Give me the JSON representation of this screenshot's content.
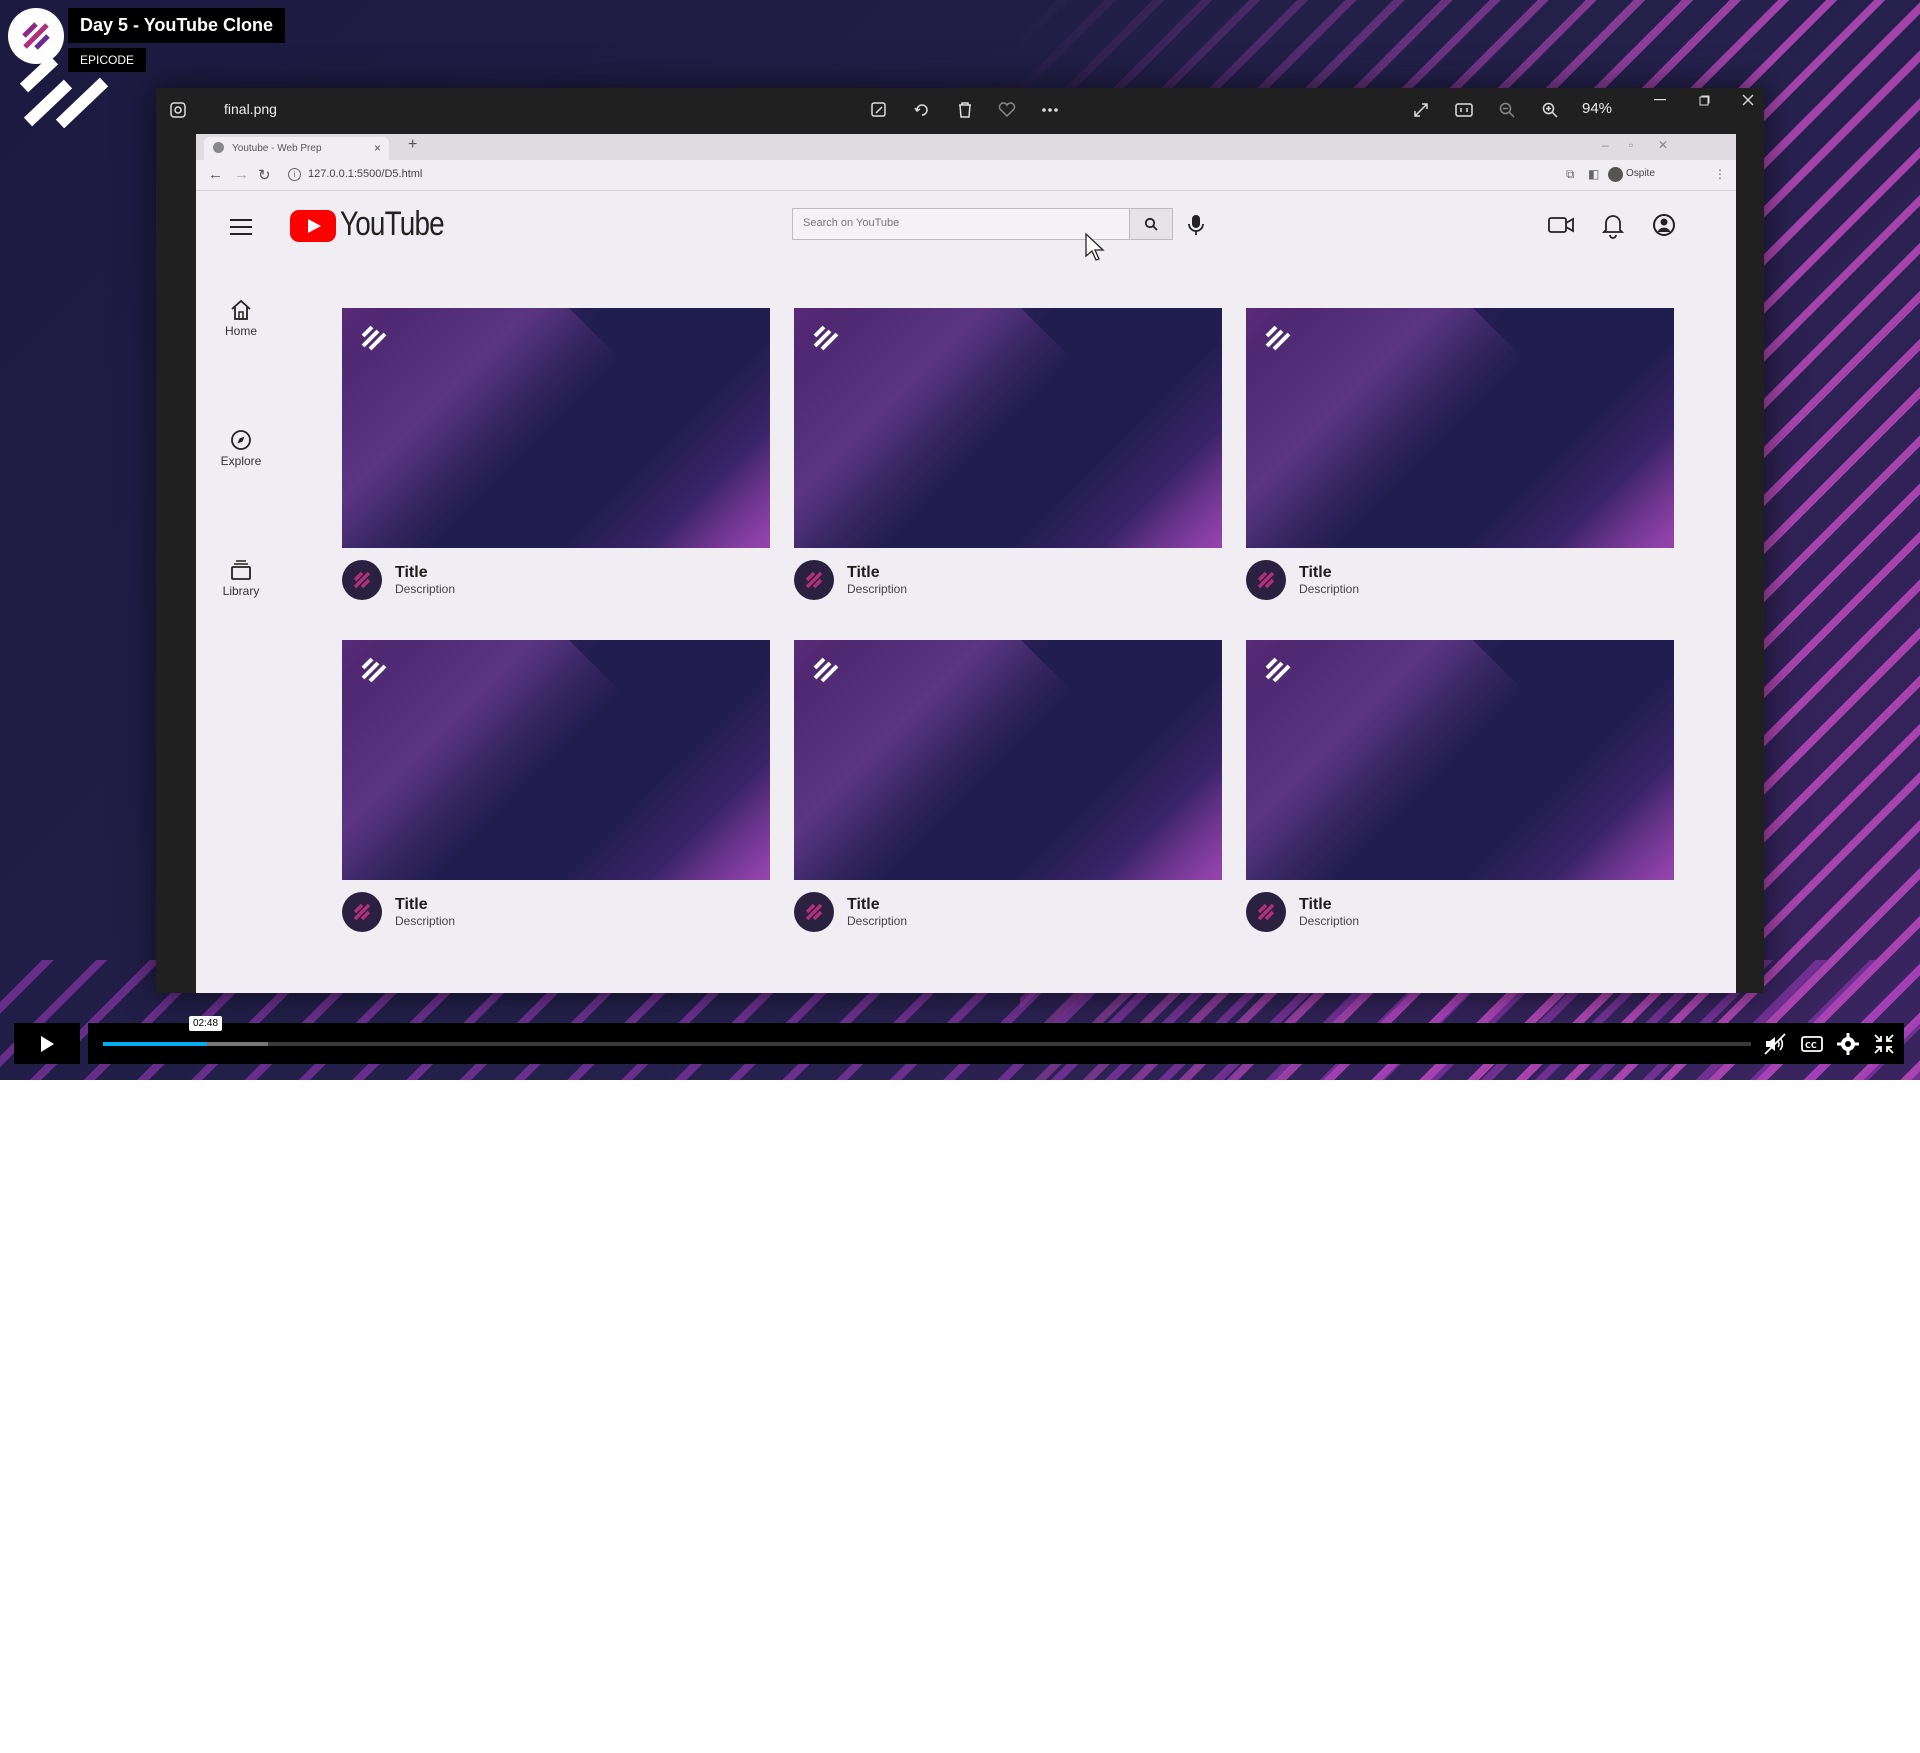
{
  "episode": {
    "title": "Day 5 - YouTube Clone",
    "tag": "EPICODE"
  },
  "viewer": {
    "filename": "final.png",
    "zoom": "94%"
  },
  "browser": {
    "tab_title": "Youtube - Web Prep",
    "tab_close": "×",
    "new_tab": "+",
    "url": "127.0.0.1:5500/D5.html",
    "profile": "Ospite"
  },
  "youtube": {
    "logo_text": "YouTube",
    "search_placeholder": "Search on YouTube",
    "sidebar": [
      {
        "label": "Home",
        "icon": "home-icon"
      },
      {
        "label": "Explore",
        "icon": "compass-icon"
      },
      {
        "label": "Library",
        "icon": "library-icon"
      }
    ],
    "videos": [
      {
        "title": "Title",
        "description": "Description"
      },
      {
        "title": "Title",
        "description": "Description"
      },
      {
        "title": "Title",
        "description": "Description"
      },
      {
        "title": "Title",
        "description": "Description"
      },
      {
        "title": "Title",
        "description": "Description"
      },
      {
        "title": "Title",
        "description": "Description"
      }
    ]
  },
  "player": {
    "time_tooltip": "02:48",
    "progress_played": 0.063,
    "progress_buffered": 0.1
  },
  "colors": {
    "accent": "#00adef",
    "brand_red": "#ff0000",
    "thumb_navy": "#211d4f",
    "thumb_purple": "#6c3290"
  }
}
